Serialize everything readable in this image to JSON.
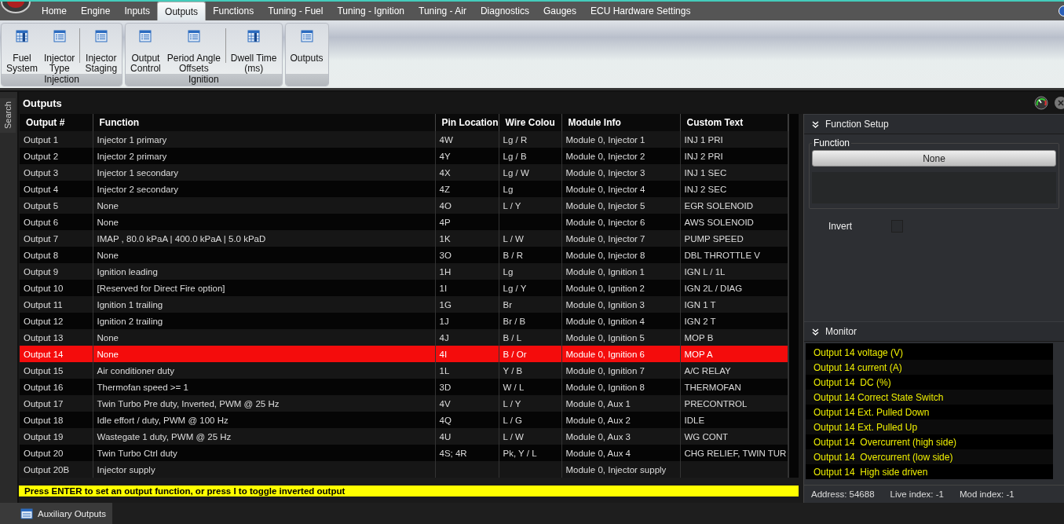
{
  "tabs": [
    {
      "label": "Home",
      "selected": false
    },
    {
      "label": "Engine",
      "selected": false
    },
    {
      "label": "Inputs",
      "selected": false
    },
    {
      "label": "Outputs",
      "selected": true
    },
    {
      "label": "Functions",
      "selected": false
    },
    {
      "label": "Tuning - Fuel",
      "selected": false
    },
    {
      "label": "Tuning - Ignition",
      "selected": false
    },
    {
      "label": "Tuning - Air",
      "selected": false
    },
    {
      "label": "Diagnostics",
      "selected": false
    },
    {
      "label": "Gauges",
      "selected": false
    },
    {
      "label": "ECU Hardware Settings",
      "selected": false
    }
  ],
  "ribbon_groups": [
    {
      "label": "Injection",
      "sections": [
        [
          {
            "label": "Fuel\nSystem",
            "kind": "grid"
          },
          {
            "label": "Injector\nType",
            "kind": "list"
          }
        ],
        [
          {
            "label": "Injector\nStaging",
            "kind": "list"
          }
        ]
      ]
    },
    {
      "label": "Ignition",
      "sections": [
        [
          {
            "label": "Output\nControl",
            "kind": "list"
          },
          {
            "label": "Period Angle\nOffsets",
            "kind": "list"
          }
        ],
        [
          {
            "label": "Dwell Time\n(ms)",
            "kind": "grid"
          }
        ]
      ]
    },
    {
      "sections": [
        [
          {
            "label": "Outputs",
            "kind": "list"
          }
        ]
      ]
    }
  ],
  "side_tab": "Search",
  "panel_title": "Outputs",
  "table": {
    "columns": [
      "Output #",
      "Function",
      "Pin Location",
      "Wire Colou",
      "Module Info",
      "Custom Text"
    ],
    "rows": [
      {
        "cells": [
          "Output 1",
          "Injector 1 primary",
          "4W",
          "Lg / R",
          "Module 0, Injector 1",
          "INJ 1 PRI"
        ],
        "selected": false
      },
      {
        "cells": [
          "Output 2",
          "Injector 2 primary",
          "4Y",
          "Lg / B",
          "Module 0, Injector 2",
          "INJ 2 PRI"
        ],
        "selected": false
      },
      {
        "cells": [
          "Output 3",
          "Injector 1 secondary",
          "4X",
          "Lg / W",
          "Module 0, Injector 3",
          "INJ 1 SEC"
        ],
        "selected": false
      },
      {
        "cells": [
          "Output 4",
          "Injector 2 secondary",
          "4Z",
          "Lg",
          "Module 0, Injector 4",
          "INJ 2 SEC"
        ],
        "selected": false
      },
      {
        "cells": [
          "Output 5",
          "None",
          "4O",
          "L / Y",
          "Module 0, Injector 5",
          "EGR SOLENOID"
        ],
        "selected": false
      },
      {
        "cells": [
          "Output 6",
          "None",
          "4P",
          "",
          "Module 0, Injector 6",
          "AWS SOLENOID"
        ],
        "selected": false
      },
      {
        "cells": [
          "Output 7",
          "IMAP , 80.0 kPaA | 400.0 kPaA | 5.0 kPaD",
          "1K",
          "L / W",
          "Module 0, Injector 7",
          "PUMP SPEED"
        ],
        "selected": false
      },
      {
        "cells": [
          "Output 8",
          "None",
          "3O",
          "B / R",
          "Module 0, Injector 8",
          "DBL THROTTLE V"
        ],
        "selected": false
      },
      {
        "cells": [
          "Output 9",
          "Ignition leading",
          "1H",
          "Lg",
          "Module 0, Ignition 1",
          "IGN L / 1L"
        ],
        "selected": false
      },
      {
        "cells": [
          "Output 10",
          "[Reserved for Direct Fire option]",
          "1I",
          "Lg / Y",
          "Module 0, Ignition 2",
          "IGN 2L / DIAG"
        ],
        "selected": false
      },
      {
        "cells": [
          "Output 11",
          "Ignition 1 trailing",
          "1G",
          "Br",
          "Module 0, Ignition 3",
          "IGN 1 T"
        ],
        "selected": false
      },
      {
        "cells": [
          "Output 12",
          "Ignition 2 trailing",
          "1J",
          "Br / B",
          "Module 0, Ignition 4",
          "IGN 2 T"
        ],
        "selected": false
      },
      {
        "cells": [
          "Output 13",
          "None",
          "4J",
          "B / L",
          "Module 0, Ignition 5",
          "MOP B"
        ],
        "selected": false
      },
      {
        "cells": [
          "Output 14",
          "None",
          "4I",
          "B / Or",
          "Module 0, Ignition 6",
          "MOP A"
        ],
        "selected": true
      },
      {
        "cells": [
          "Output 15",
          "Air conditioner duty",
          "1L",
          "Y / B",
          "Module 0, Ignition 7",
          "A/C RELAY"
        ],
        "selected": false
      },
      {
        "cells": [
          "Output 16",
          "Thermofan speed >= 1",
          "3D",
          "W / L",
          "Module 0, Ignition 8",
          "THERMOFAN"
        ],
        "selected": false
      },
      {
        "cells": [
          "Output 17",
          "Twin Turbo Pre duty, Inverted, PWM @ 25 Hz",
          "4V",
          "L / Y",
          "Module 0, Aux 1",
          "PRECONTROL"
        ],
        "selected": false
      },
      {
        "cells": [
          "Output 18",
          "Idle effort / duty, PWM @ 100 Hz",
          "4Q",
          "L / G",
          "Module 0, Aux 2",
          "IDLE"
        ],
        "selected": false
      },
      {
        "cells": [
          "Output 19",
          "Wastegate 1 duty, PWM @ 25 Hz",
          "4U",
          "L / W",
          "Module 0, Aux 3",
          "WG CONT"
        ],
        "selected": false
      },
      {
        "cells": [
          "Output 20",
          "Twin Turbo Ctrl duty",
          "4S; 4R",
          "Pk, Y / L",
          "Module 0, Aux 4",
          "CHG RELIEF, TWIN TUR"
        ],
        "selected": false
      },
      {
        "cells": [
          "Output 20B",
          "Injector supply",
          "",
          "",
          "Module 0, Injector supply",
          ""
        ],
        "selected": false
      }
    ]
  },
  "hint": "Press ENTER to set an output function, or press I to toggle inverted output",
  "function_setup": {
    "title": "Function Setup",
    "group_label": "Function",
    "button": "None",
    "invert_label": "Invert",
    "invert_checked": false
  },
  "monitor": {
    "title": "Monitor",
    "items": [
      "Output 14 voltage (V)",
      "Output 14 current (A)",
      "Output 14  DC (%)",
      "Output 14 Correct State Switch",
      "Output 14 Ext. Pulled Down",
      "Output 14 Ext. Pulled Up",
      "Output 14  Overcurrent (high side)",
      "Output 14  Overcurrent (low side)",
      "Output 14  High side driven"
    ]
  },
  "status": [
    "Address: 54688",
    "Live index: -1",
    "Mod index: -1"
  ],
  "bottom_tab": "Auxiliary Outputs"
}
